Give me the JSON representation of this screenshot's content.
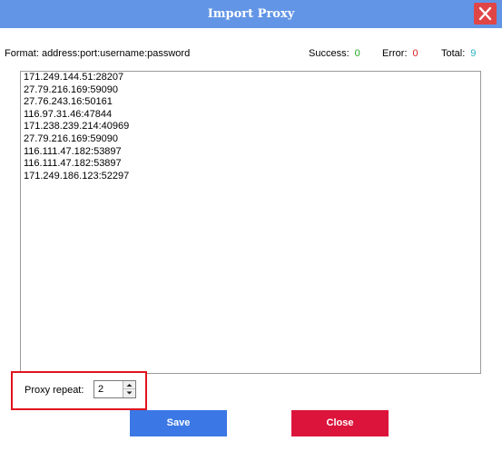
{
  "window": {
    "title": "Import Proxy"
  },
  "icons": {
    "close": "close-x-icon",
    "spin_up": "chevron-up-icon",
    "spin_down": "chevron-down-icon"
  },
  "info": {
    "format_label": "Format: address:port:username:password",
    "success_label": "Success:",
    "success_value": "0",
    "error_label": "Error:",
    "error_value": "0",
    "total_label": "Total:",
    "total_value": "9"
  },
  "proxies": [
    "171.249.144.51:28207",
    "27.79.216.169:59090",
    "27.76.243.16:50161",
    "116.97.31.46:47844",
    "171.238.239.214:40969",
    "27.79.216.169:59090",
    "116.111.47.182:53897",
    "116.111.47.182:53897",
    "171.249.186.123:52297"
  ],
  "repeat": {
    "label": "Proxy repeat:",
    "value": "2"
  },
  "buttons": {
    "save_label": "Save",
    "close_label": "Close"
  },
  "colors": {
    "titlebar": "#6295e6",
    "close_icon_bg": "#e04646",
    "success": "#22aa22",
    "error": "#dd2222",
    "total": "#27b0c8",
    "highlight_border": "#e0141e",
    "save_button": "#3b78e5",
    "close_button": "#dc143c"
  }
}
